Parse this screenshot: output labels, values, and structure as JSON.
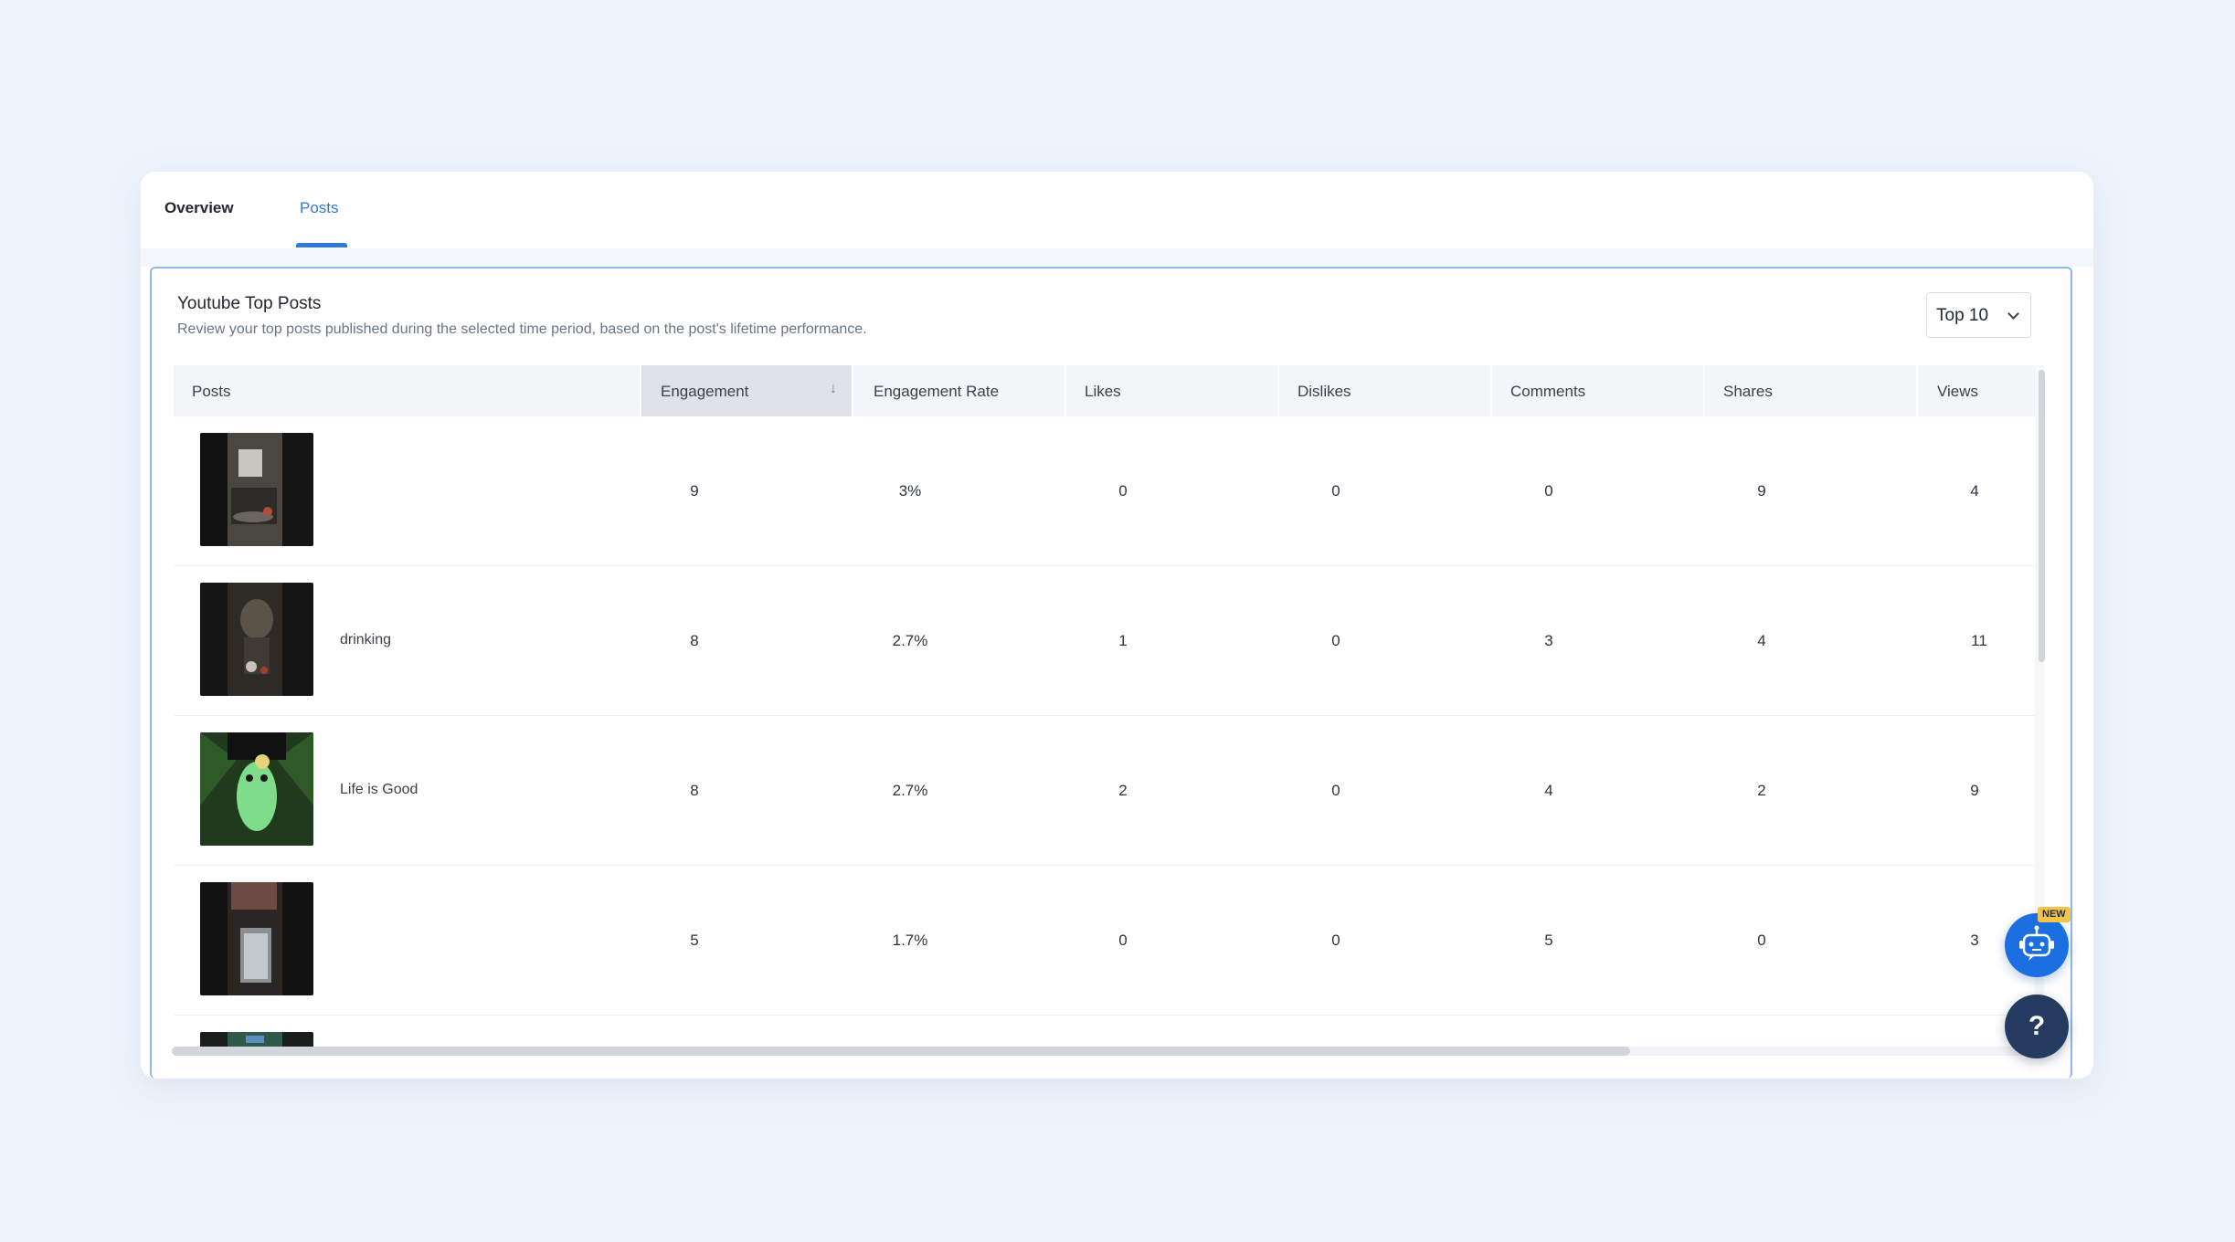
{
  "tabs": [
    {
      "label": "Overview",
      "active": false
    },
    {
      "label": "Posts",
      "active": true
    }
  ],
  "card": {
    "title": "Youtube Top Posts",
    "subtitle": "Review your top posts published during the selected time period, based on the post's lifetime performance.",
    "top_select": "Top 10"
  },
  "table": {
    "headers": [
      "Posts",
      "Engagement",
      "Engagement Rate",
      "Likes",
      "Dislikes",
      "Comments",
      "Shares",
      "Views"
    ],
    "sorted_column": "Engagement",
    "sort_direction": "descending",
    "rows": [
      {
        "title": "",
        "engagement": "9",
        "rate": "3%",
        "likes": "0",
        "dislikes": "0",
        "comments": "0",
        "shares": "9",
        "views": "4"
      },
      {
        "title": "drinking",
        "engagement": "8",
        "rate": "2.7%",
        "likes": "1",
        "dislikes": "0",
        "comments": "3",
        "shares": "4",
        "views": "11"
      },
      {
        "title": "Life is Good",
        "engagement": "8",
        "rate": "2.7%",
        "likes": "2",
        "dislikes": "0",
        "comments": "4",
        "shares": "2",
        "views": "9"
      },
      {
        "title": "",
        "engagement": "5",
        "rate": "1.7%",
        "likes": "0",
        "dislikes": "0",
        "comments": "5",
        "shares": "0",
        "views": "3"
      }
    ]
  },
  "floating": {
    "new_badge": "NEW",
    "help_label": "?"
  },
  "colors": {
    "accent": "#2f7ad6",
    "bot_button": "#1b6fe0",
    "help_button": "#243a5e"
  }
}
